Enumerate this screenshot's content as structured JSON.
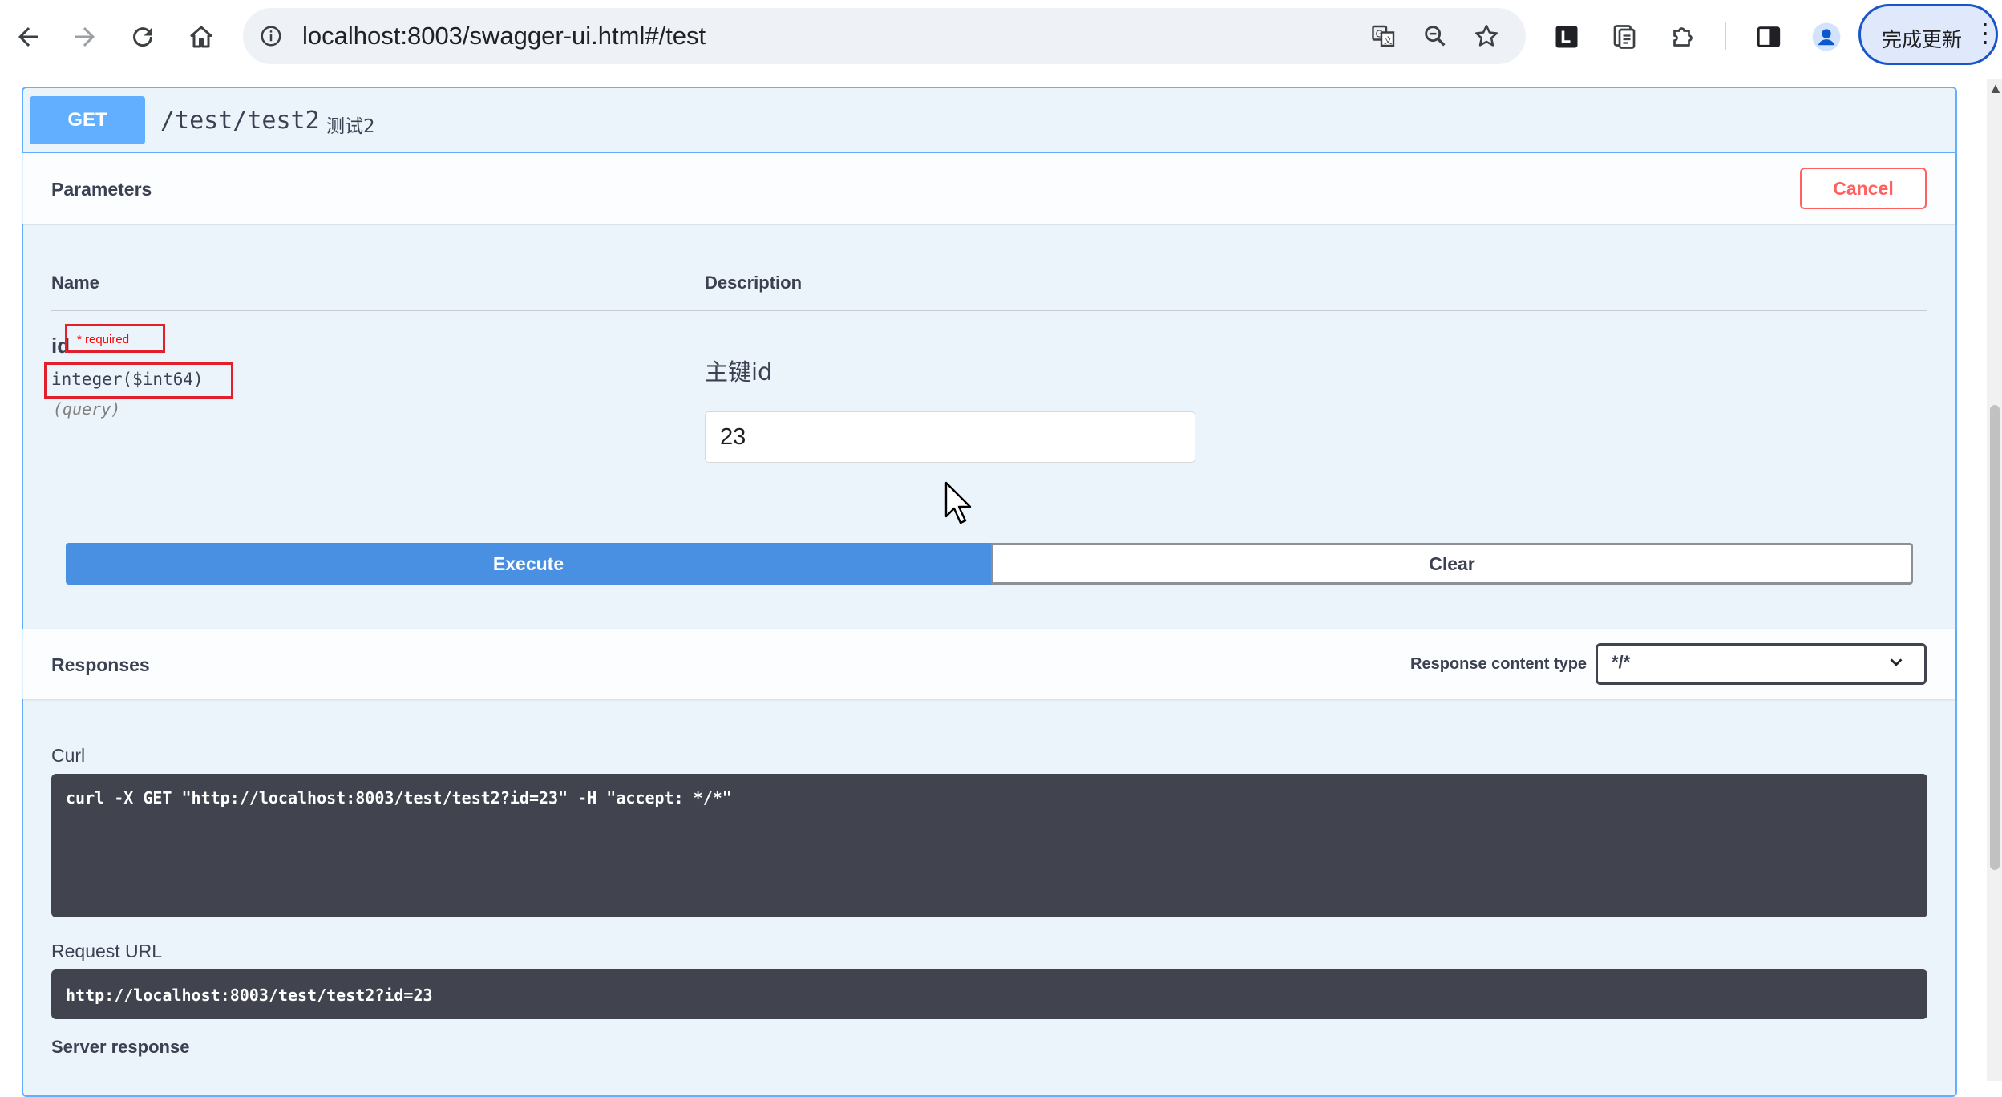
{
  "browser": {
    "url": "localhost:8003/swagger-ui.html#/test",
    "update_label": "完成更新",
    "update_menu_glyph": "⋮",
    "nav_icons": [
      "back-arrow-icon",
      "forward-arrow-icon",
      "reload-icon",
      "home-icon"
    ],
    "omnibox_icons": [
      "site-info-icon",
      "translate-icon",
      "zoom-icon",
      "bookmark-star-icon"
    ],
    "extension_icons": [
      "extension-l-icon",
      "reading-list-icon",
      "puzzle-extensions-icon",
      "side-panel-icon",
      "profile-avatar-icon"
    ]
  },
  "operation": {
    "method": "GET",
    "path": "/test/test2",
    "summary": "测试2",
    "method_color": "#61affe"
  },
  "parameters": {
    "title": "Parameters",
    "cancel_label": "Cancel",
    "col_name": "Name",
    "col_description": "Description",
    "items": [
      {
        "name": "id",
        "required_label": "* required",
        "type": "integer($int64)",
        "in": "(query)",
        "description": "主键id",
        "value": "23"
      }
    ],
    "execute_label": "Execute",
    "clear_label": "Clear"
  },
  "responses": {
    "title": "Responses",
    "content_type_label": "Response content type",
    "content_type_value": "*/*",
    "curl_label": "Curl",
    "curl_command": "curl -X GET \"http://localhost:8003/test/test2?id=23\" -H \"accept: */*\"",
    "request_url_label": "Request URL",
    "request_url": "http://localhost:8003/test/test2?id=23",
    "server_response_label": "Server response"
  }
}
